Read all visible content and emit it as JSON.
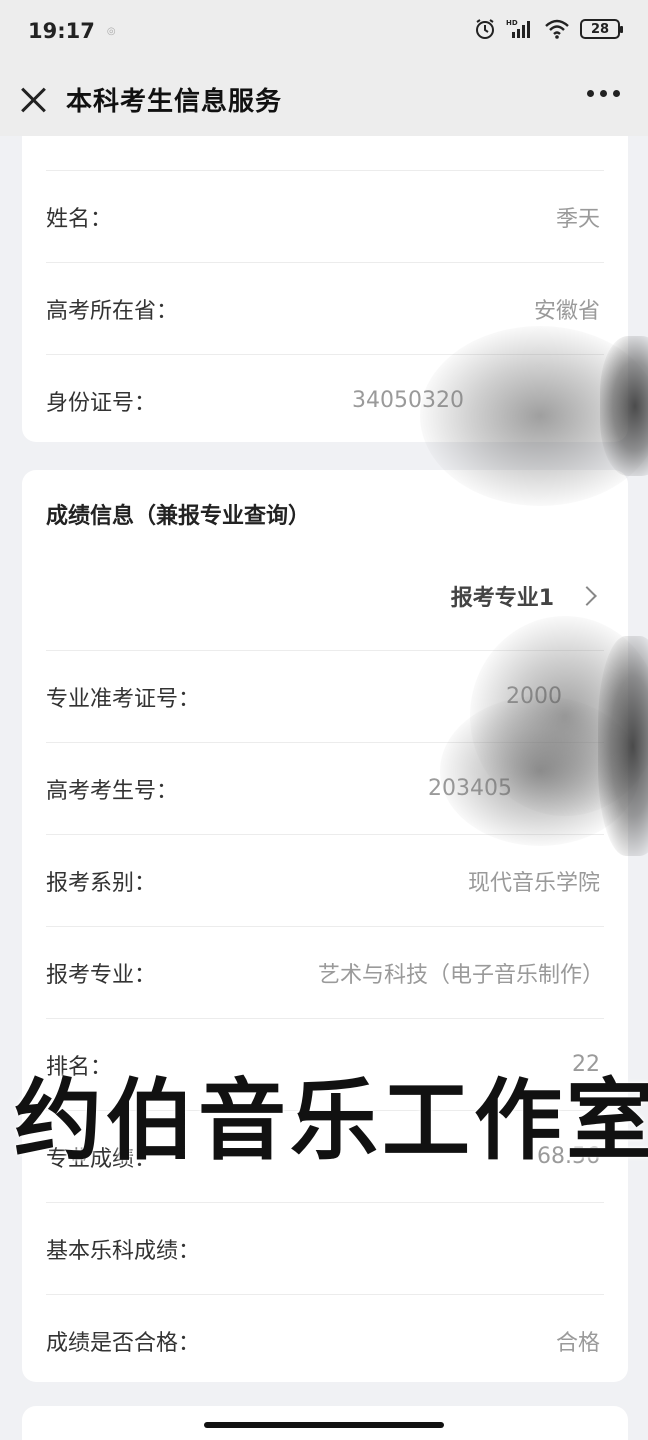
{
  "status_bar": {
    "time": "19:17",
    "dot": "◎",
    "battery": "28",
    "icons": [
      "alarm-icon",
      "hd-signal-icon",
      "wifi-icon",
      "battery-icon"
    ]
  },
  "nav": {
    "title": "本科考生信息服务"
  },
  "basic_info": {
    "rows": [
      {
        "label": "姓名：",
        "value": "季天"
      },
      {
        "label": "高考所在省：",
        "value": "安徽省"
      },
      {
        "label": "身份证号：",
        "value": "34050320"
      }
    ]
  },
  "score_info": {
    "title": "成绩信息（兼报专业查询）",
    "major_link": "报考专业1",
    "rows": [
      {
        "label": "专业准考证号：",
        "value": "2000"
      },
      {
        "label": "高考考生号：",
        "value": "203405"
      },
      {
        "label": "报考系别：",
        "value": "现代音乐学院"
      },
      {
        "label": "报考专业：",
        "value": "艺术与科技（电子音乐制作）"
      },
      {
        "label": "排名：",
        "value": "22"
      },
      {
        "label": "专业成绩：",
        "value": "68.56"
      },
      {
        "label": "基本乐科成绩：",
        "value": ""
      },
      {
        "label": "成绩是否合格：",
        "value": "合格"
      }
    ]
  },
  "watermark": "约伯音乐工作室"
}
